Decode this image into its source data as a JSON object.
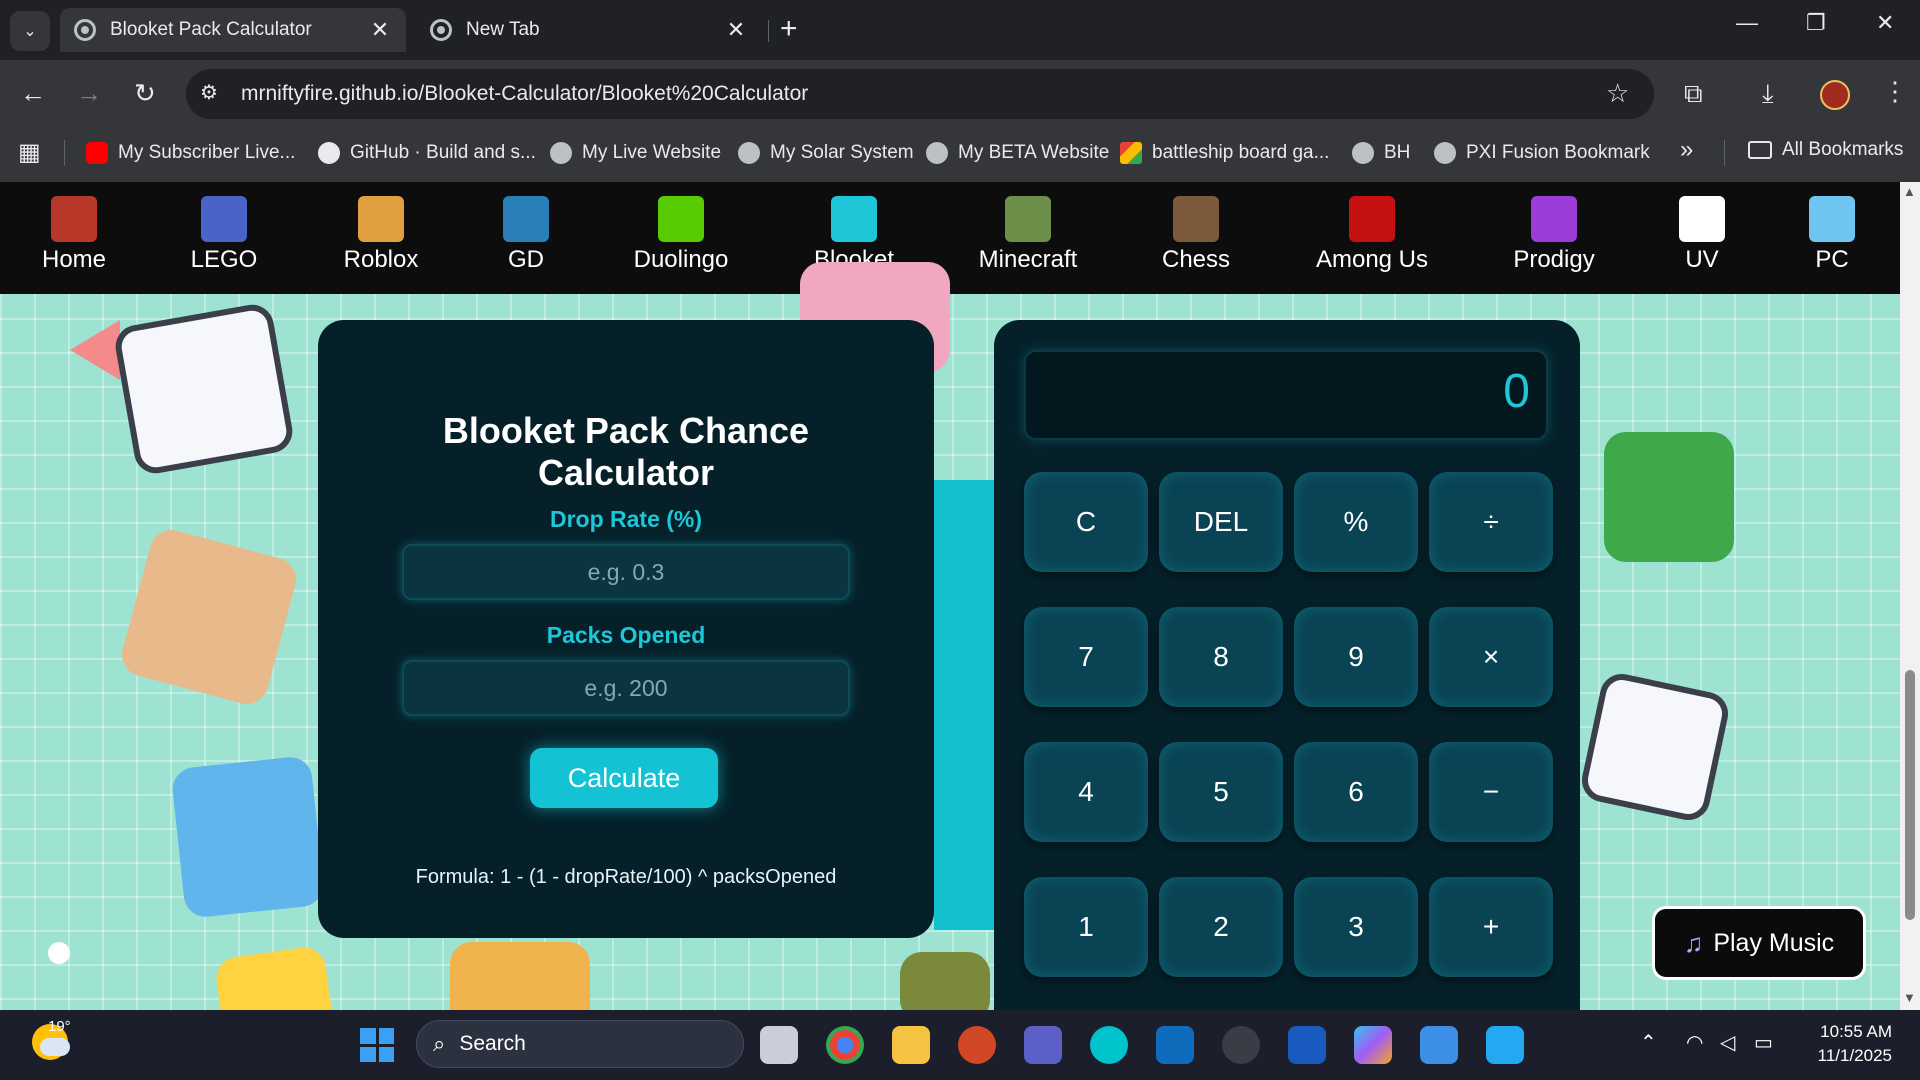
{
  "browser": {
    "tabs": [
      {
        "title": "Blooket Pack Calculator",
        "close": "✕"
      },
      {
        "title": "New Tab",
        "close": "✕"
      }
    ],
    "new_tab": "+",
    "url": "mrniftyfire.github.io/Blooket-Calculator/Blooket%20Calculator",
    "bookmarks": [
      {
        "label": "My Subscriber Live...",
        "icon": "youtube-icon"
      },
      {
        "label": "GitHub · Build and s...",
        "icon": "github-icon"
      },
      {
        "label": "My Live Website",
        "icon": "globe-icon"
      },
      {
        "label": "My Solar System",
        "icon": "globe-icon"
      },
      {
        "label": "My BETA Website",
        "icon": "globe-icon"
      },
      {
        "label": "battleship board ga...",
        "icon": "cube-icon"
      },
      {
        "label": "BH",
        "icon": "globe-icon"
      },
      {
        "label": "PXI Fusion Bookmark",
        "icon": "globe-icon"
      }
    ],
    "bookmarks_overflow": "»",
    "all_bookmarks": "All Bookmarks"
  },
  "site_nav": [
    {
      "label": "Home",
      "color": "#b8392a"
    },
    {
      "label": "LEGO",
      "color": "#4a63c9"
    },
    {
      "label": "Roblox",
      "color": "#e0a040"
    },
    {
      "label": "GD",
      "color": "#2b7fb8"
    },
    {
      "label": "Duolingo",
      "color": "#58cc02"
    },
    {
      "label": "Blooket",
      "color": "#1ec6d8"
    },
    {
      "label": "Minecraft",
      "color": "#6d8f4a"
    },
    {
      "label": "Chess",
      "color": "#7a5a3a"
    },
    {
      "label": "Among Us",
      "color": "#c51111"
    },
    {
      "label": "Prodigy",
      "color": "#9b3dd6"
    },
    {
      "label": "UV",
      "color": "#ffffff"
    },
    {
      "label": "PC",
      "color": "#6ec6f0"
    }
  ],
  "calculator_form": {
    "title_line1": "Blooket Pack Chance",
    "title_line2": "Calculator",
    "drop_rate_label": "Drop Rate (%)",
    "drop_rate_placeholder": "e.g. 0.3",
    "packs_label": "Packs Opened",
    "packs_placeholder": "e.g. 200",
    "calculate_button": "Calculate",
    "formula": "Formula: 1 - (1 - dropRate/100) ^ packsOpened"
  },
  "calculator": {
    "display": "0",
    "keys": [
      [
        "C",
        "DEL",
        "%",
        "÷"
      ],
      [
        "7",
        "8",
        "9",
        "×"
      ],
      [
        "4",
        "5",
        "6",
        "−"
      ],
      [
        "1",
        "2",
        "3",
        "+"
      ]
    ]
  },
  "play_music": {
    "icon": "music-note-icon",
    "label": "Play Music"
  },
  "taskbar": {
    "weather": "19°",
    "search": "Search",
    "time": "10:55 AM",
    "date": "11/1/2025"
  },
  "colors": {
    "accent": "#1ec6d8",
    "card_bg": "#052029",
    "page_bg": "#9ee3d2"
  }
}
